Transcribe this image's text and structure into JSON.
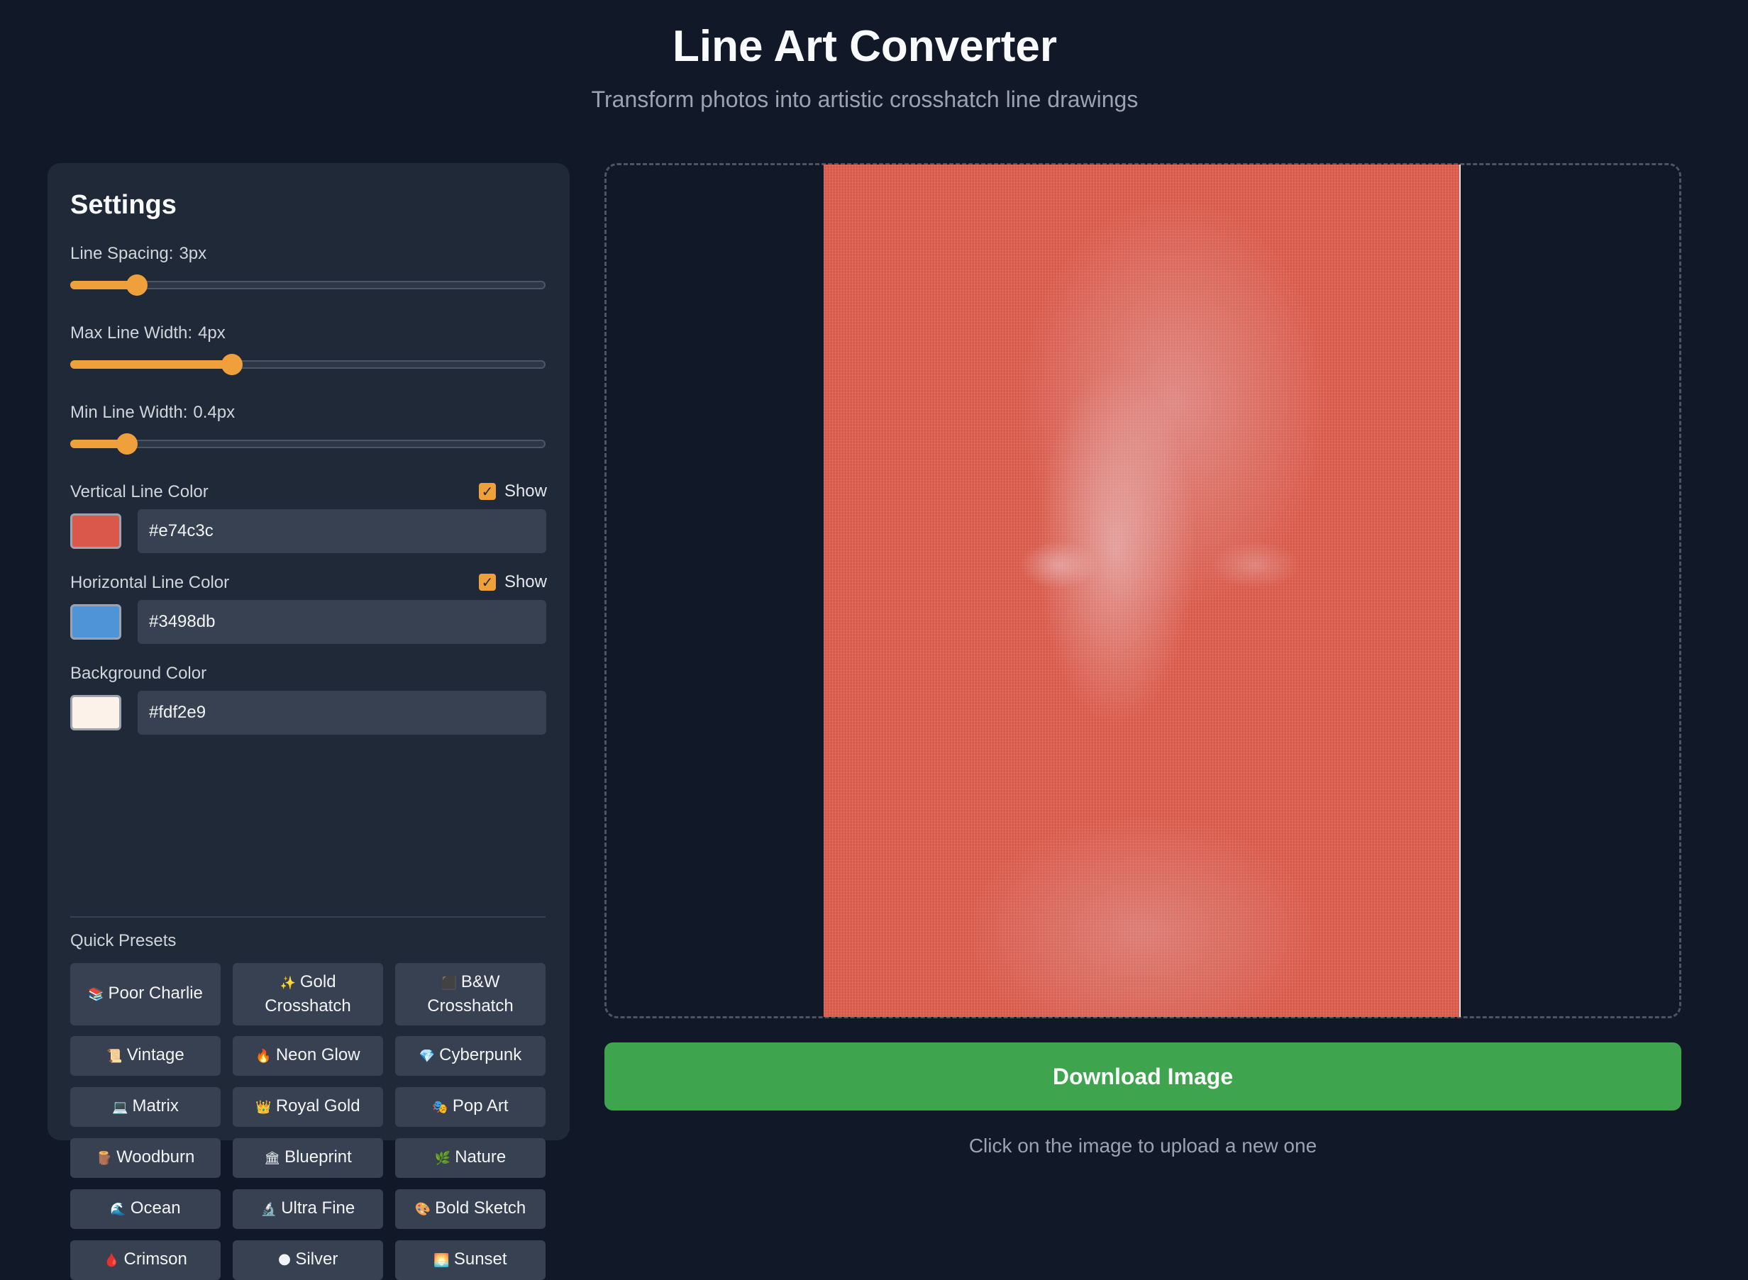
{
  "header": {
    "title": "Line Art Converter",
    "subtitle": "Transform photos into artistic crosshatch line drawings"
  },
  "settings": {
    "title": "Settings",
    "line_spacing": {
      "label": "Line Spacing:",
      "value": "3px",
      "fraction": 0.14
    },
    "max_line_width": {
      "label": "Max Line Width:",
      "value": "4px",
      "fraction": 0.34
    },
    "min_line_width": {
      "label": "Min Line Width:",
      "value": "0.4px",
      "fraction": 0.12
    },
    "vertical": {
      "label": "Vertical Line Color",
      "show_label": "Show",
      "show": true,
      "hex": "#e74c3c",
      "swatch": "#d9574b"
    },
    "horizontal": {
      "label": "Horizontal Line Color",
      "show_label": "Show",
      "show": true,
      "hex": "#3498db",
      "swatch": "#4f94d6"
    },
    "background": {
      "label": "Background Color",
      "hex": "#fdf2e9",
      "swatch": "#fdf2e9"
    },
    "presets_label": "Quick Presets",
    "presets": [
      {
        "icon": "books-icon",
        "emoji": "📚",
        "label": "Poor Charlie"
      },
      {
        "icon": "sparkles-icon",
        "emoji": "✨",
        "label": "Gold Crosshatch"
      },
      {
        "icon": "black-square-icon",
        "emoji": "⬛",
        "label": "B&W Crosshatch"
      },
      {
        "icon": "scroll-icon",
        "emoji": "📜",
        "label": "Vintage"
      },
      {
        "icon": "fire-icon",
        "emoji": "🔥",
        "label": "Neon Glow"
      },
      {
        "icon": "gem-icon",
        "emoji": "💎",
        "label": "Cyberpunk"
      },
      {
        "icon": "laptop-icon",
        "emoji": "💻",
        "label": "Matrix"
      },
      {
        "icon": "crown-icon",
        "emoji": "👑",
        "label": "Royal Gold"
      },
      {
        "icon": "performing-arts-icon",
        "emoji": "🎭",
        "label": "Pop Art"
      },
      {
        "icon": "wood-icon",
        "emoji": "🪵",
        "label": "Woodburn"
      },
      {
        "icon": "classical-building-icon",
        "emoji": "🏛",
        "label": "Blueprint"
      },
      {
        "icon": "herb-icon",
        "emoji": "🌿",
        "label": "Nature"
      },
      {
        "icon": "wave-icon",
        "emoji": "🌊",
        "label": "Ocean"
      },
      {
        "icon": "microscope-icon",
        "emoji": "🔬",
        "label": "Ultra Fine"
      },
      {
        "icon": "palette-icon",
        "emoji": "🎨",
        "label": "Bold Sketch"
      },
      {
        "icon": "drop-of-blood-icon",
        "emoji": "🩸",
        "label": "Crimson"
      },
      {
        "icon": "moon-icon",
        "emoji": "🌑",
        "label": "Silver"
      },
      {
        "icon": "sunset-icon",
        "emoji": "🌅",
        "label": "Sunset"
      }
    ]
  },
  "preview": {
    "accent": "#d9594a"
  },
  "download_label": "Download Image",
  "hint": "Click on the image to upload a new one"
}
